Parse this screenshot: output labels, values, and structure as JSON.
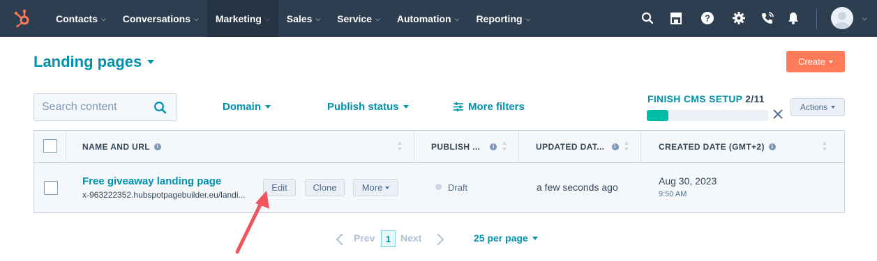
{
  "nav": {
    "items": [
      {
        "label": "Contacts",
        "active": false
      },
      {
        "label": "Conversations",
        "active": false
      },
      {
        "label": "Marketing",
        "active": true
      },
      {
        "label": "Sales",
        "active": false
      },
      {
        "label": "Service",
        "active": false
      },
      {
        "label": "Automation",
        "active": false
      },
      {
        "label": "Reporting",
        "active": false
      }
    ],
    "chevron": "⌵",
    "right_icons": [
      "search-icon",
      "marketplace-icon",
      "help-icon",
      "settings-icon",
      "calling-icon",
      "notifications-icon"
    ]
  },
  "header": {
    "title": "Landing pages",
    "create_label": "Create"
  },
  "filters": {
    "search_placeholder": "Search content",
    "domain_label": "Domain",
    "publish_status_label": "Publish status",
    "more_filters_label": "More filters"
  },
  "setup": {
    "label": "FINISH CMS SETUP",
    "count": "2/11",
    "progress": 0.18
  },
  "actions_label": "Actions",
  "table": {
    "columns": [
      {
        "label": "NAME AND URL"
      },
      {
        "label": "PUBLISH ..."
      },
      {
        "label": "UPDATED DAT..."
      },
      {
        "label": "CREATED DATE (GMT+2)"
      }
    ],
    "rows": [
      {
        "title": "Free giveaway landing page",
        "url": "x-963222352.hubspotpagebuilder.eu/landi...",
        "edit_label": "Edit",
        "clone_label": "Clone",
        "more_label": "More",
        "status": "Draft",
        "updated": "a few seconds ago",
        "created_date": "Aug 30, 2023",
        "created_time": "9:50 AM"
      }
    ]
  },
  "pagination": {
    "prev_label": "Prev",
    "current_page": "1",
    "next_label": "Next",
    "per_page_label": "25 per page"
  },
  "colors": {
    "nav_bg": "#2d3e50",
    "accent": "#0091ae",
    "create": "#ff7a59",
    "progress": "#00bda5",
    "arrow": "#f2545b"
  }
}
